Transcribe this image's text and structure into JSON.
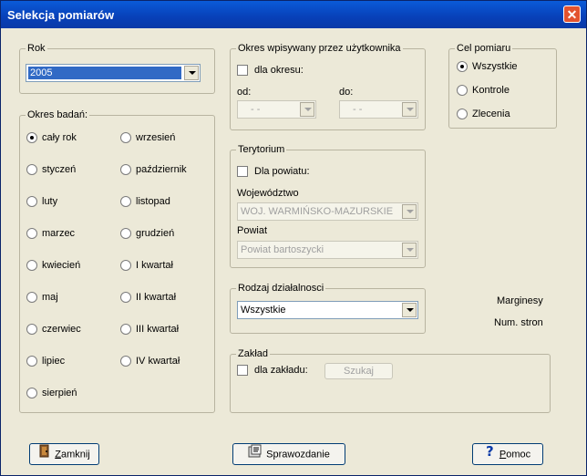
{
  "window": {
    "title": "Selekcja pomiarów",
    "close_label": "✕"
  },
  "rok": {
    "legend": "Rok",
    "value": "2005"
  },
  "okres": {
    "legend": "Okres badań:",
    "options": [
      "cały rok",
      "styczeń",
      "luty",
      "marzec",
      "kwiecień",
      "maj",
      "czerwiec",
      "lipiec",
      "sierpień",
      "wrzesień",
      "październik",
      "listopad",
      "grudzień",
      "I kwartał",
      "II kwartał",
      "III kwartał",
      "IV kwartał"
    ],
    "selected": "cały rok"
  },
  "okres_user": {
    "legend": "Okres wpisywany przez użytkownika",
    "checkbox_label": "dla okresu:",
    "od_label": "od:",
    "do_label": "do:",
    "od_value": "- -",
    "do_value": "- -"
  },
  "terytorium": {
    "legend": "Terytorium",
    "checkbox_label": "Dla powiatu:",
    "woj_label": "Województwo",
    "woj_value": "WOJ. WARMIŃSKO-MAZURSKIE",
    "powiat_label": "Powiat",
    "powiat_value": "Powiat bartoszycki"
  },
  "rodzaj": {
    "legend": "Rodzaj działalnosci",
    "value": "Wszystkie"
  },
  "zaklad": {
    "legend": "Zakład",
    "checkbox_label": "dla zakładu:",
    "szukaj_label": "Szukaj"
  },
  "cel": {
    "legend": "Cel pomiaru",
    "options": [
      "Wszystkie",
      "Kontrole",
      "Zlecenia"
    ],
    "selected": "Wszystkie"
  },
  "margins": {
    "marginesy": "Marginesy",
    "num_stron": "Num. stron"
  },
  "buttons": {
    "zamknij": "Zamknij",
    "sprawozdanie": "Sprawozdanie",
    "pomoc": "Pomoc"
  }
}
